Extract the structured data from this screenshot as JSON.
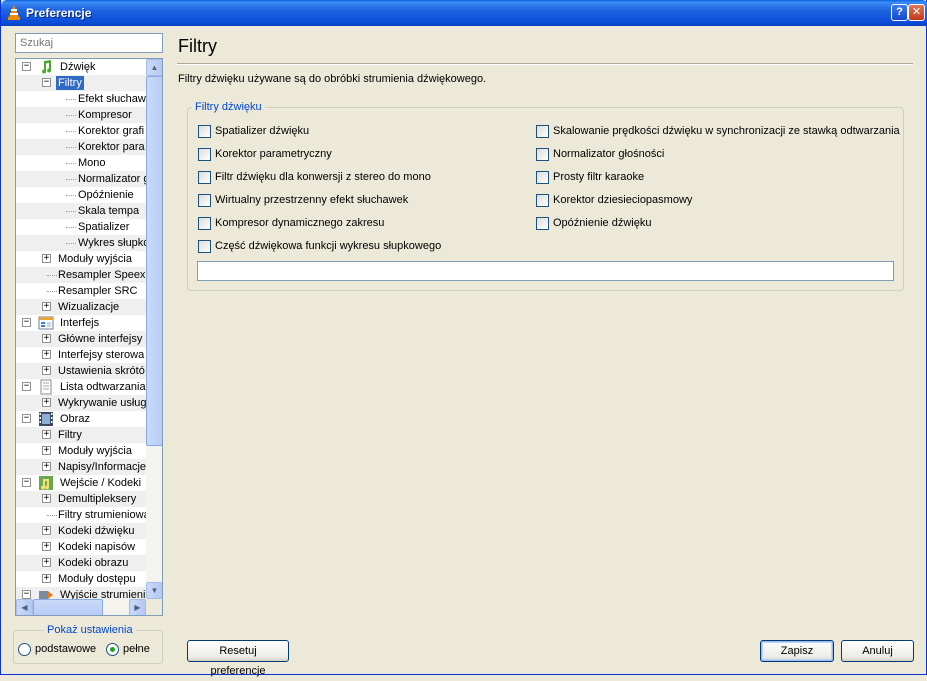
{
  "window": {
    "title": "Preferencje",
    "help_glyph": "?",
    "close_glyph": "✕"
  },
  "search": {
    "placeholder": "Szukaj"
  },
  "tree": {
    "items": [
      {
        "label": "Dźwięk",
        "icon": "music-note-icon",
        "level": 0,
        "expander": "−"
      },
      {
        "label": "Filtry",
        "level": 1,
        "expander": "−",
        "selected": true
      },
      {
        "label": "Efekt słuchaw",
        "level": 2
      },
      {
        "label": "Kompresor",
        "level": 2
      },
      {
        "label": "Korektor grafi",
        "level": 2
      },
      {
        "label": "Korektor para",
        "level": 2
      },
      {
        "label": "Mono",
        "level": 2
      },
      {
        "label": "Normalizator g",
        "level": 2
      },
      {
        "label": "Opóźnienie",
        "level": 2
      },
      {
        "label": "Skala tempa",
        "level": 2
      },
      {
        "label": "Spatializer",
        "level": 2
      },
      {
        "label": "Wykres słupko",
        "level": 2
      },
      {
        "label": "Moduły wyjścia",
        "level": 1,
        "expander": "+"
      },
      {
        "label": "Resampler Speex",
        "level": 1
      },
      {
        "label": "Resampler SRC",
        "level": 1
      },
      {
        "label": "Wizualizacje",
        "level": 1,
        "expander": "+"
      },
      {
        "label": "Interfejs",
        "icon": "interface-icon",
        "level": 0,
        "expander": "−"
      },
      {
        "label": "Główne interfejsy",
        "level": 1,
        "expander": "+"
      },
      {
        "label": "Interfejsy sterowa",
        "level": 1,
        "expander": "+"
      },
      {
        "label": "Ustawienia skrótó",
        "level": 1,
        "expander": "+"
      },
      {
        "label": "Lista odtwarzania",
        "icon": "playlist-icon",
        "level": 0,
        "expander": "−"
      },
      {
        "label": "Wykrywanie usług",
        "level": 1,
        "expander": "+"
      },
      {
        "label": "Obraz",
        "icon": "film-icon",
        "level": 0,
        "expander": "−"
      },
      {
        "label": "Filtry",
        "level": 1,
        "expander": "+"
      },
      {
        "label": "Moduły wyjścia",
        "level": 1,
        "expander": "+"
      },
      {
        "label": "Napisy/Informacje",
        "level": 1,
        "expander": "+"
      },
      {
        "label": "Wejście / Kodeki",
        "icon": "codec-icon",
        "level": 0,
        "expander": "−"
      },
      {
        "label": "Demultipleksery",
        "level": 1,
        "expander": "+"
      },
      {
        "label": "Filtry strumieniowa",
        "level": 1
      },
      {
        "label": "Kodeki dźwięku",
        "level": 1,
        "expander": "+"
      },
      {
        "label": "Kodeki napisów",
        "level": 1,
        "expander": "+"
      },
      {
        "label": "Kodeki obrazu",
        "level": 1,
        "expander": "+"
      },
      {
        "label": "Moduły dostępu",
        "level": 1,
        "expander": "+"
      },
      {
        "label": "Wyjście strumieni",
        "icon": "stream-output-icon",
        "level": 0,
        "expander": "−"
      }
    ]
  },
  "show_settings": {
    "legend": "Pokaż ustawienia",
    "options": [
      {
        "label": "podstawowe",
        "selected": false
      },
      {
        "label": "pełne",
        "selected": true
      }
    ]
  },
  "panel": {
    "title": "Filtry",
    "description": "Filtry dźwięku używane są do obróbki strumienia dźwiękowego.",
    "group_legend": "Filtry dźwięku",
    "filters_left": [
      {
        "label": "Spatializer dźwięku",
        "checked": false
      },
      {
        "label": "Korektor parametryczny",
        "checked": false
      },
      {
        "label": "Filtr dźwięku dla konwersji z stereo do mono",
        "checked": false
      },
      {
        "label": "Wirtualny przestrzenny efekt słuchawek",
        "checked": false
      },
      {
        "label": "Kompresor dynamicznego zakresu",
        "checked": false
      },
      {
        "label": "Część dźwiękowa funkcji wykresu słupkowego",
        "checked": false
      }
    ],
    "filters_right": [
      {
        "label": "Skalowanie prędkości dźwięku w synchronizacji ze stawką odtwarzania",
        "checked": false
      },
      {
        "label": "Normalizator głośności",
        "checked": false
      },
      {
        "label": "Prosty filtr karaoke",
        "checked": false
      },
      {
        "label": "Korektor dziesieciopasmowy",
        "checked": false
      },
      {
        "label": "Opóźnienie dźwięku",
        "checked": false
      }
    ],
    "filter_text_value": ""
  },
  "buttons": {
    "reset": "Resetuj preferencje",
    "save": "Zapisz",
    "cancel": "Anuluj"
  }
}
